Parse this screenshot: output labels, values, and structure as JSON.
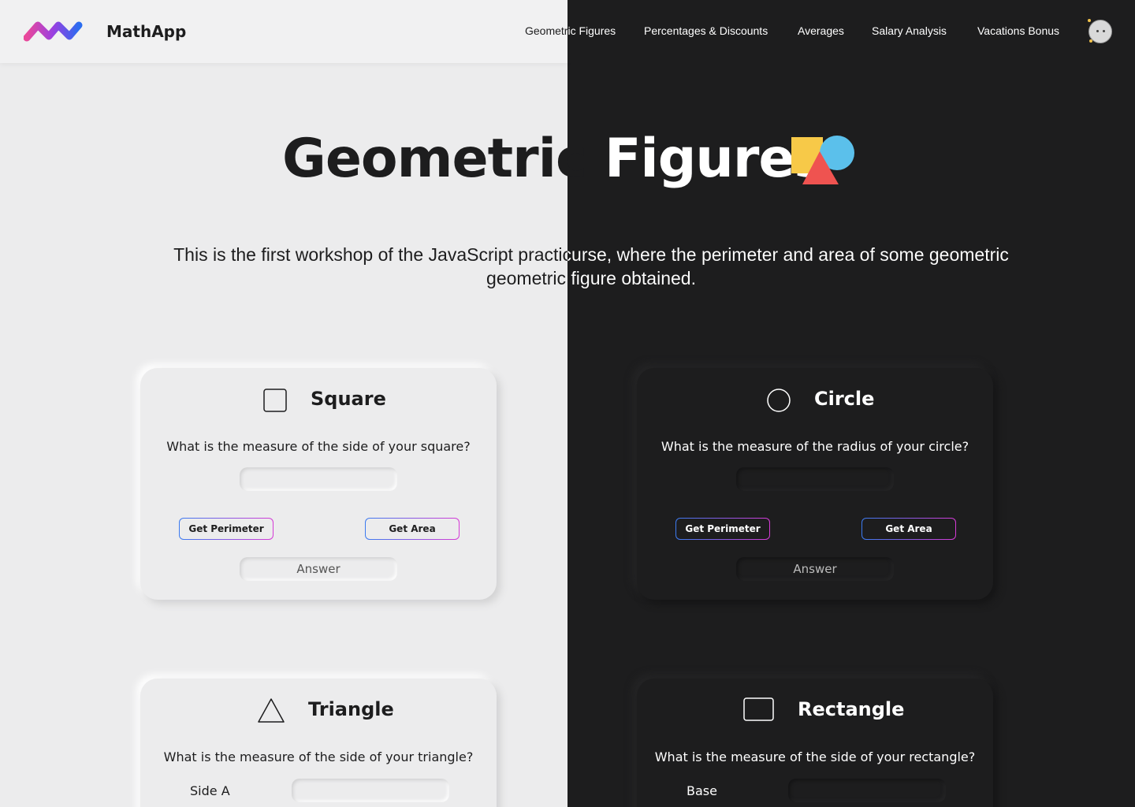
{
  "header": {
    "brand": "MathApp",
    "nav": [
      {
        "label_dark_part": "Geometr",
        "label_light_part": "ic Figures"
      },
      {
        "label": "Percentages & Discounts"
      },
      {
        "label": "Averages"
      },
      {
        "label": "Salary Analysis"
      },
      {
        "label": "Vacations Bonus"
      }
    ]
  },
  "hero": {
    "title_dark_part": "Geometric ",
    "title_light_part": "Figures",
    "description": "This is the first workshop of the JavaScript practicurse, where the perimeter and area of some geometric geometric figure obtained."
  },
  "cards": {
    "square": {
      "title": "Square",
      "question": "What is the measure of the side of your square?",
      "input_value": "",
      "perimeter_button": "Get Perimeter",
      "area_button": "Get Area",
      "answer": "Answer"
    },
    "circle": {
      "title": "Circle",
      "question": "What is the measure of the radius of your circle?",
      "input_value": "",
      "perimeter_button": "Get Perimeter",
      "area_button": "Get Area",
      "answer": "Answer"
    },
    "triangle": {
      "title": "Triangle",
      "question": "What is the measure of the side of your triangle?",
      "field_label": "Side A",
      "input_value": ""
    },
    "rectangle": {
      "title": "Rectangle",
      "question": "What is the measure of the side of your rectangle?",
      "field_label": "Base",
      "input_value": ""
    }
  },
  "colors": {
    "light_bg": "#ececed",
    "dark_bg": "#1d1d1e",
    "button_gradient_start": "#3b7bf0",
    "button_gradient_end": "#d63bd6"
  }
}
